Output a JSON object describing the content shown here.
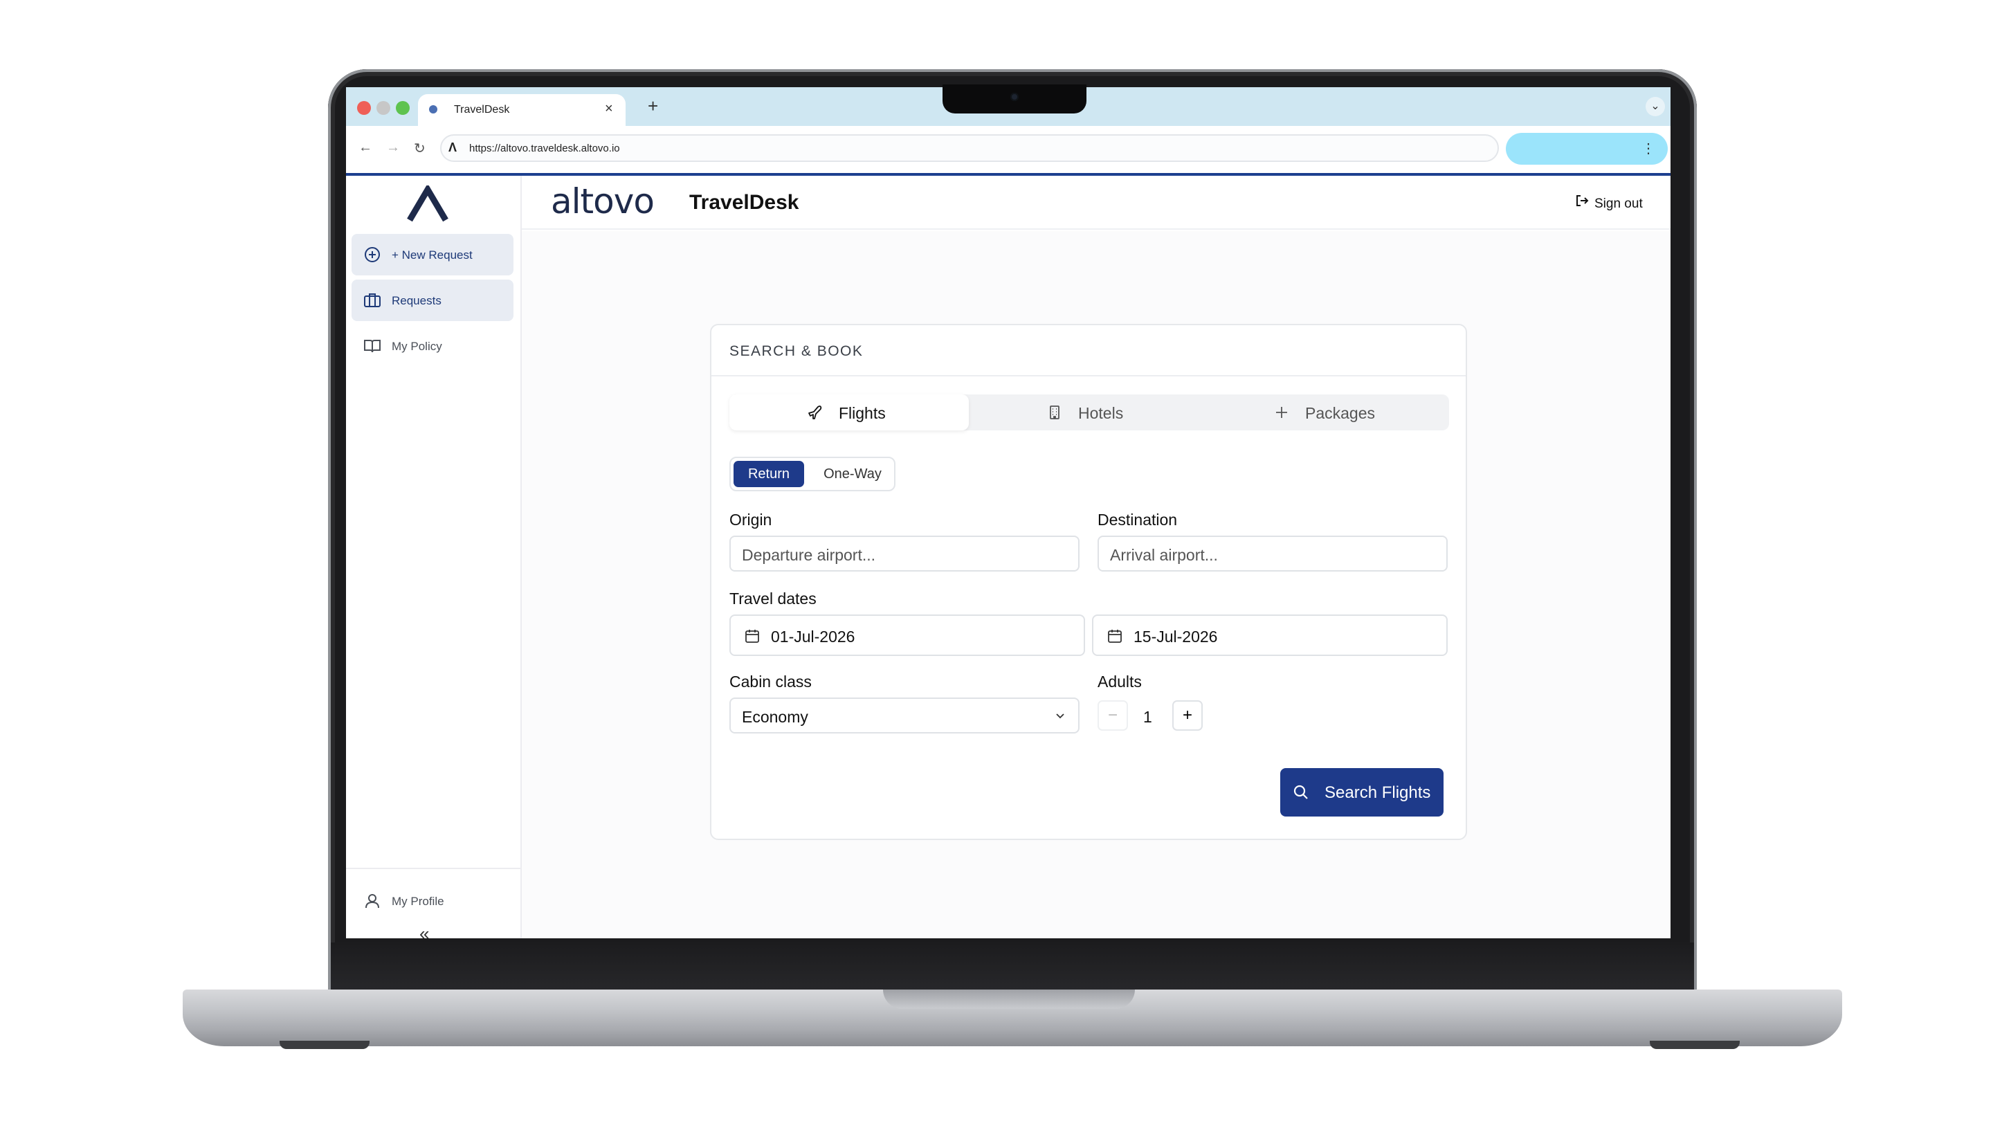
{
  "browser": {
    "tab_title": "TravelDesk",
    "new_tab": "+",
    "close": "×",
    "url": "https://altovo.traveldesk.altovo.io",
    "menu": "⋮"
  },
  "sidebar": {
    "items": [
      {
        "label": "+ New Request",
        "icon": "plus-circle-icon"
      },
      {
        "label": "Requests",
        "icon": "briefcase-icon"
      },
      {
        "label": "My Policy",
        "icon": "book-icon"
      }
    ],
    "profile_label": "My Profile",
    "collapse": "«"
  },
  "header": {
    "brand": "altovo",
    "product": "TravelDesk",
    "signout": "Sign out"
  },
  "search_card": {
    "title": "SEARCH & BOOK",
    "tabs": [
      {
        "label": "Flights",
        "icon": "plane-icon",
        "active": true
      },
      {
        "label": "Hotels",
        "icon": "building-icon",
        "active": false
      },
      {
        "label": "Packages",
        "icon": "plus-icon",
        "active": false
      }
    ],
    "trip_types": [
      "Return",
      "One-Way"
    ],
    "origin": {
      "label": "Origin",
      "placeholder": "Departure airport..."
    },
    "destination": {
      "label": "Destination",
      "placeholder": "Arrival airport..."
    },
    "travel_dates": {
      "label": "Travel dates",
      "depart": "01-Jul-2026",
      "return": "15-Jul-2026"
    },
    "cabin": {
      "label": "Cabin class",
      "value": "Economy"
    },
    "adults": {
      "label": "Adults",
      "value": "1",
      "minus": "−",
      "plus": "+"
    },
    "search_button": "Search Flights"
  },
  "colors": {
    "primary": "#1e3a8a",
    "tab_bar": "#cfe7f2",
    "extension_pill": "#9be4fb"
  }
}
